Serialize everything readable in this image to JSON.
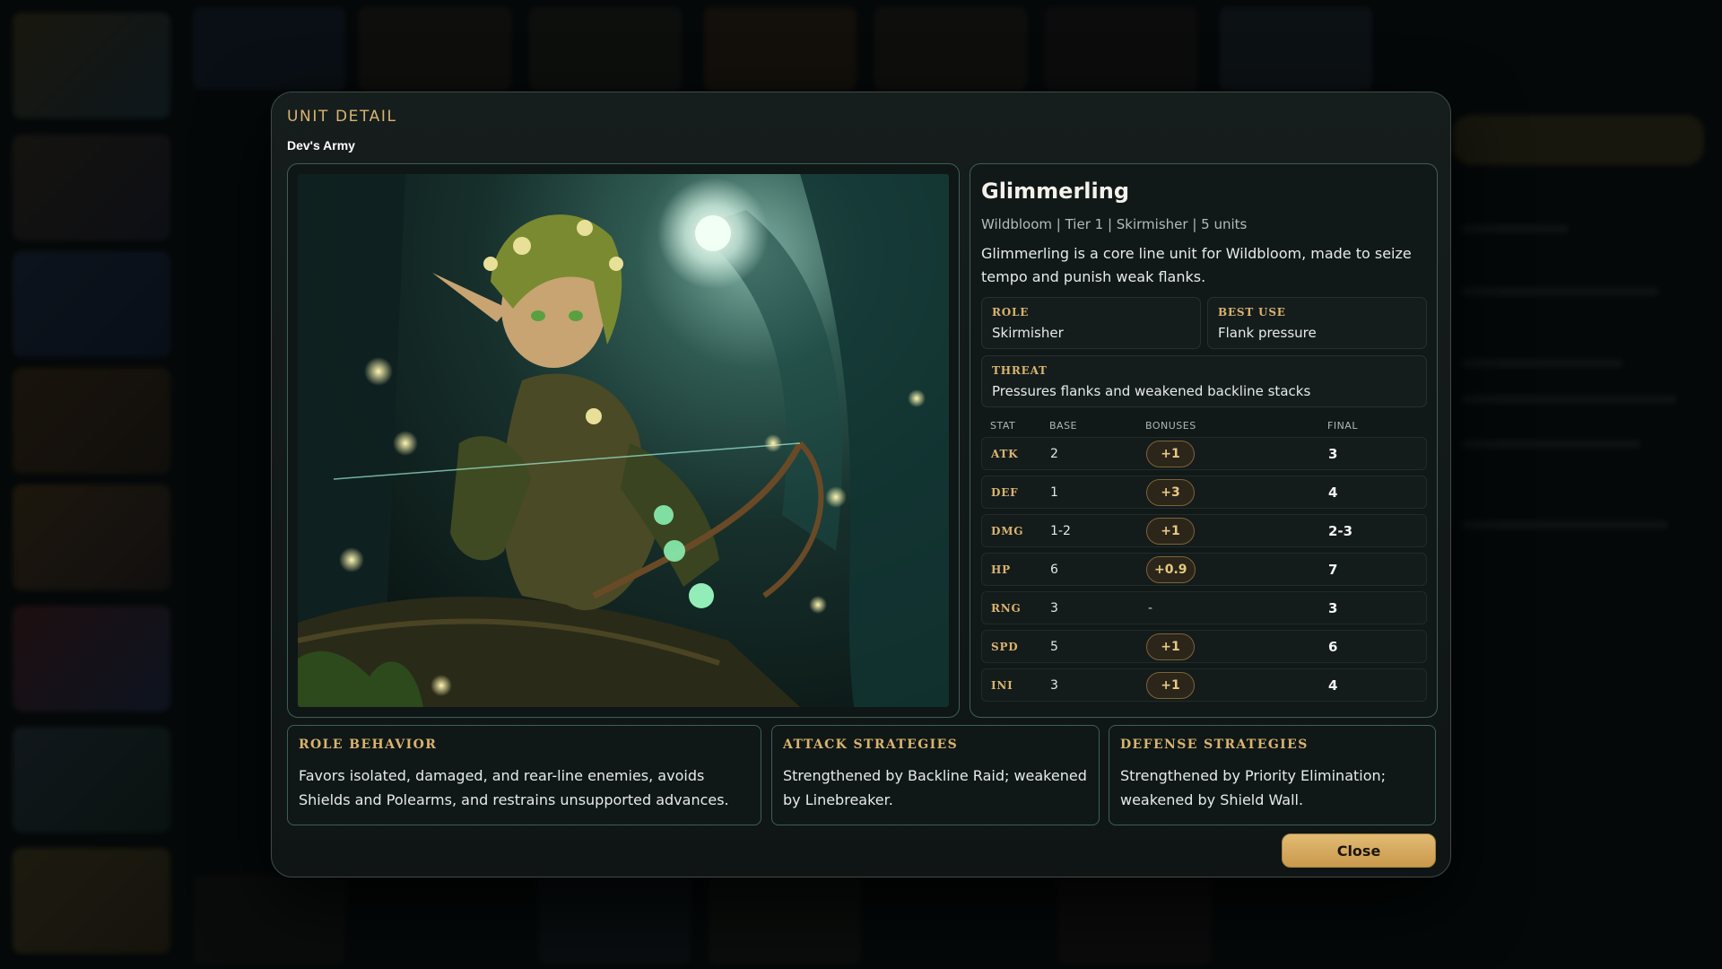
{
  "modal": {
    "title": "UNIT DETAIL",
    "army": "Dev's Army",
    "close_label": "Close"
  },
  "unit": {
    "name": "Glimmerling",
    "meta": "Wildbloom | Tier 1 | Skirmisher | 5 units",
    "description": "Glimmerling is a core line unit for Wildbloom, made to seize tempo and punish weak flanks.",
    "role_label": "ROLE",
    "role": "Skirmisher",
    "best_use_label": "BEST USE",
    "best_use": "Flank pressure",
    "threat_label": "THREAT",
    "threat": "Pressures flanks and weakened backline stacks"
  },
  "stats": {
    "headers": [
      "STAT",
      "BASE",
      "BONUSES",
      "FINAL"
    ],
    "rows": [
      {
        "stat": "ATK",
        "base": "2",
        "bonus": "+1",
        "final": "3"
      },
      {
        "stat": "DEF",
        "base": "1",
        "bonus": "+3",
        "final": "4"
      },
      {
        "stat": "DMG",
        "base": "1-2",
        "bonus": "+1",
        "final": "2-3"
      },
      {
        "stat": "HP",
        "base": "6",
        "bonus": "+0.9",
        "final": "7"
      },
      {
        "stat": "RNG",
        "base": "3",
        "bonus": "-",
        "final": "3"
      },
      {
        "stat": "SPD",
        "base": "5",
        "bonus": "+1",
        "final": "6"
      },
      {
        "stat": "INI",
        "base": "3",
        "bonus": "+1",
        "final": "4"
      }
    ]
  },
  "strategies": {
    "role_behavior_label": "ROLE BEHAVIOR",
    "role_behavior": "Favors isolated, damaged, and rear-line enemies, avoids Shields and Polearms, and restrains unsupported advances.",
    "attack_label": "ATTACK STRATEGIES",
    "attack": "Strengthened by Backline Raid; weakened by Linebreaker.",
    "defense_label": "DEFENSE STRATEGIES",
    "defense": "Strengthened by Priority Elimination; weakened by Shield Wall."
  },
  "colors": {
    "accent_gold": "#d8b46e",
    "panel_border": "#3c6058",
    "button_gold": "#e2bb74"
  }
}
